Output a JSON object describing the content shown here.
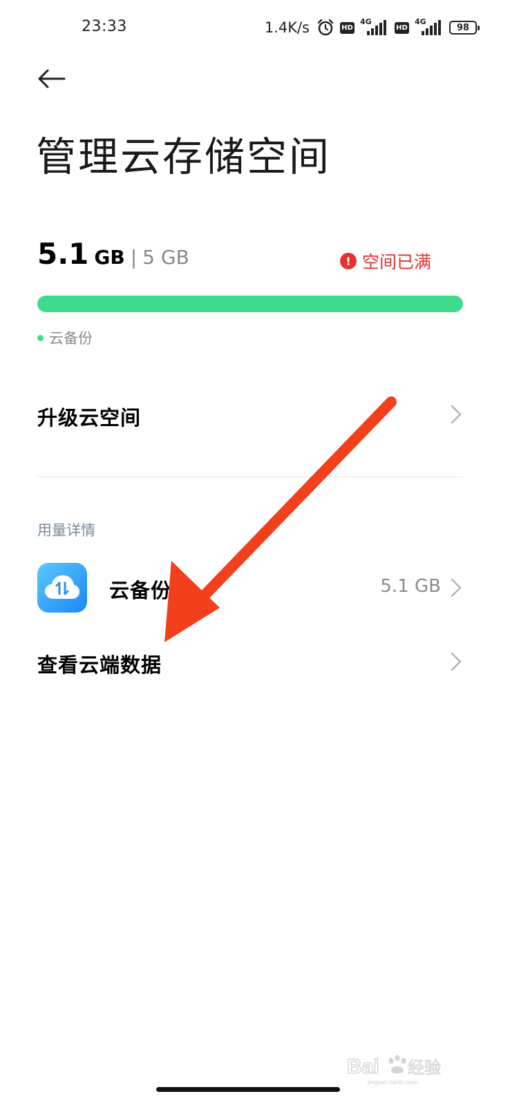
{
  "status_bar": {
    "time": "23:33",
    "net_speed": "1.4K/s",
    "hd_label": "HD",
    "network_type": "4G",
    "battery": "98"
  },
  "header": {
    "title": "管理云存储空间"
  },
  "storage": {
    "used_value": "5.1",
    "used_unit": "GB",
    "separator": "|",
    "total": "5 GB",
    "status": "空间已满",
    "usage_fraction": 1.0,
    "legend_label": "云备份",
    "colors": {
      "bar": "#3ddc8c",
      "status": "#e6312c"
    }
  },
  "menu": {
    "upgrade_label": "升级云空间",
    "section_label": "用量详情",
    "backup_label": "云备份",
    "backup_size": "5.1 GB",
    "view_cloud_label": "查看云端数据"
  },
  "watermark": {
    "text": "Bai du 经验",
    "subtext": "jingyan.baidu.com"
  },
  "icons": {
    "back": "back-arrow-icon",
    "warning": "warning-icon",
    "chevron": "chevron-right-icon",
    "app": "cloud-backup-icon"
  }
}
